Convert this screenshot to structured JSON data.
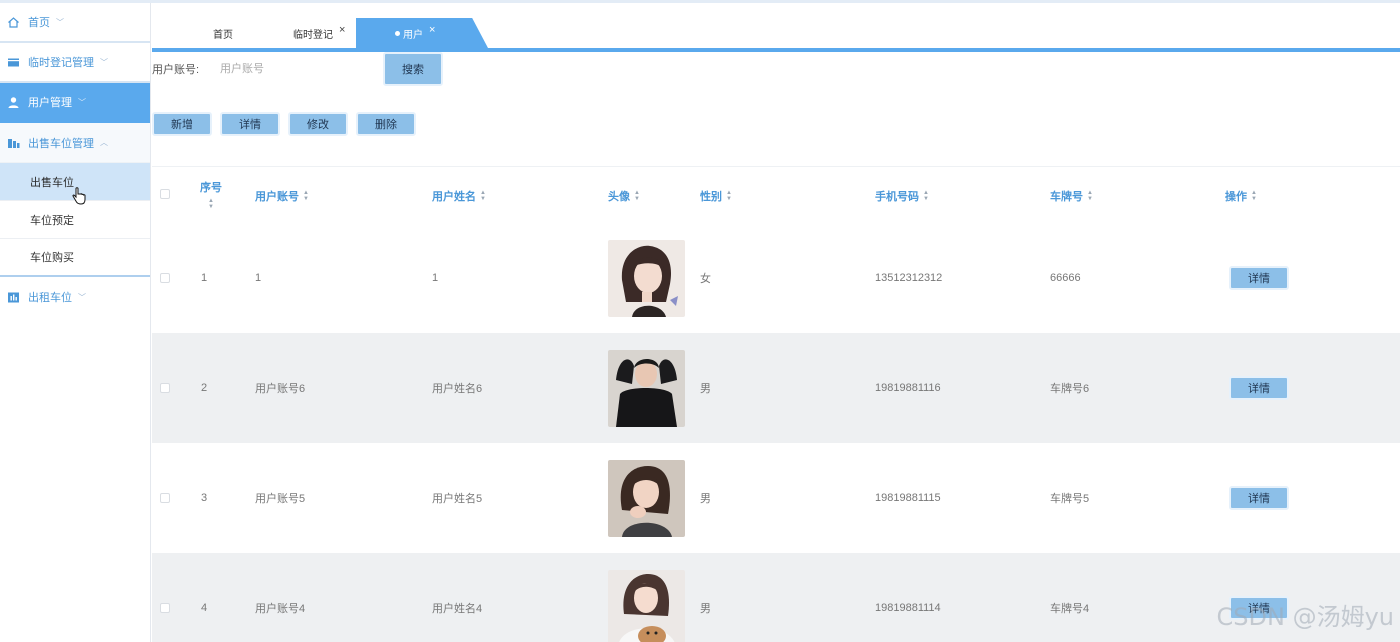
{
  "sidebar": {
    "items": [
      {
        "label": "首页",
        "icon": "home-icon",
        "state": "normal"
      },
      {
        "label": "临时登记管理",
        "icon": "card-icon",
        "state": "normal"
      },
      {
        "label": "用户管理",
        "icon": "user-icon",
        "state": "active"
      },
      {
        "label": "出售车位管理",
        "icon": "building-icon",
        "state": "open"
      },
      {
        "label": "出租车位",
        "icon": "chart-icon",
        "state": "normal"
      }
    ],
    "sub_items": [
      {
        "label": "出售车位",
        "selected": true
      },
      {
        "label": "车位预定",
        "selected": false
      },
      {
        "label": "车位购买",
        "selected": false
      }
    ]
  },
  "tabs": [
    {
      "label": "首页",
      "closable": false,
      "active": false
    },
    {
      "label": "临时登记",
      "closable": true,
      "active": false
    },
    {
      "label": "用户",
      "closable": true,
      "active": true
    }
  ],
  "tab_close_glyph": "×",
  "search": {
    "label": "用户账号:",
    "placeholder": "用户账号",
    "value": "",
    "button": "搜索"
  },
  "actions": [
    "新增",
    "详情",
    "修改",
    "删除"
  ],
  "table": {
    "columns": [
      "序号",
      "用户账号",
      "用户姓名",
      "头像",
      "性别",
      "手机号码",
      "车牌号",
      "操作"
    ],
    "rows": [
      {
        "index": "1",
        "account": "1",
        "name": "1",
        "gender": "女",
        "phone": "13512312312",
        "plate": "66666",
        "action": "详情"
      },
      {
        "index": "2",
        "account": "用户账号6",
        "name": "用户姓名6",
        "gender": "男",
        "phone": "19819881116",
        "plate": "车牌号6",
        "action": "详情"
      },
      {
        "index": "3",
        "account": "用户账号5",
        "name": "用户姓名5",
        "gender": "男",
        "phone": "19819881115",
        "plate": "车牌号5",
        "action": "详情"
      },
      {
        "index": "4",
        "account": "用户账号4",
        "name": "用户姓名4",
        "gender": "男",
        "phone": "19819881114",
        "plate": "车牌号4",
        "action": "详情"
      }
    ]
  },
  "watermark": "CSDN @汤姆yu",
  "colors": {
    "accent": "#5aa9ed",
    "button": "#8cbfe8",
    "header_text": "#4a97d8"
  }
}
